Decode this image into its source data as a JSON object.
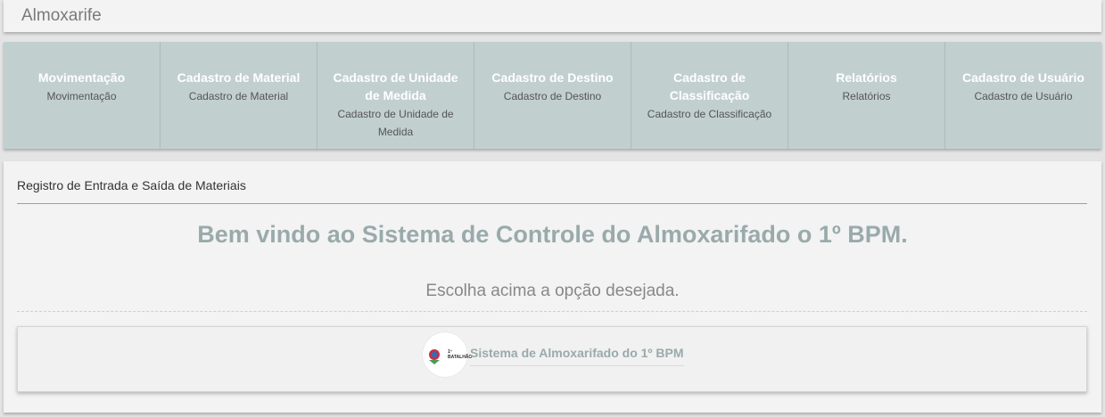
{
  "header": {
    "brand": "Almoxarife"
  },
  "nav": {
    "items": [
      {
        "title": "Movimentação",
        "subtitle": "Movimentação"
      },
      {
        "title": "Cadastro de Material",
        "subtitle": "Cadastro de Material"
      },
      {
        "title": "Cadastro de Unidade de Medida",
        "subtitle": "Cadastro de Unidade de Medida"
      },
      {
        "title": "Cadastro de Destino",
        "subtitle": "Cadastro de Destino"
      },
      {
        "title": "Cadastro de Classificação",
        "subtitle": "Cadastro de Classificação"
      },
      {
        "title": "Relatórios",
        "subtitle": "Relatórios"
      },
      {
        "title": "Cadastro de Usuário",
        "subtitle": "Cadastro de Usuário"
      }
    ]
  },
  "main": {
    "panel_title": "Registro de Entrada e Saída de Materiais",
    "welcome": "Bem vindo ao Sistema de Controle do Almoxarifado o 1º BPM.",
    "instruction": "Escolha acima a opção desejada."
  },
  "footer": {
    "logo_text": "1º BATALHÃO POLÍCIA MILITAR",
    "text": "Sistema de Almoxarifado do 1º BPM"
  }
}
